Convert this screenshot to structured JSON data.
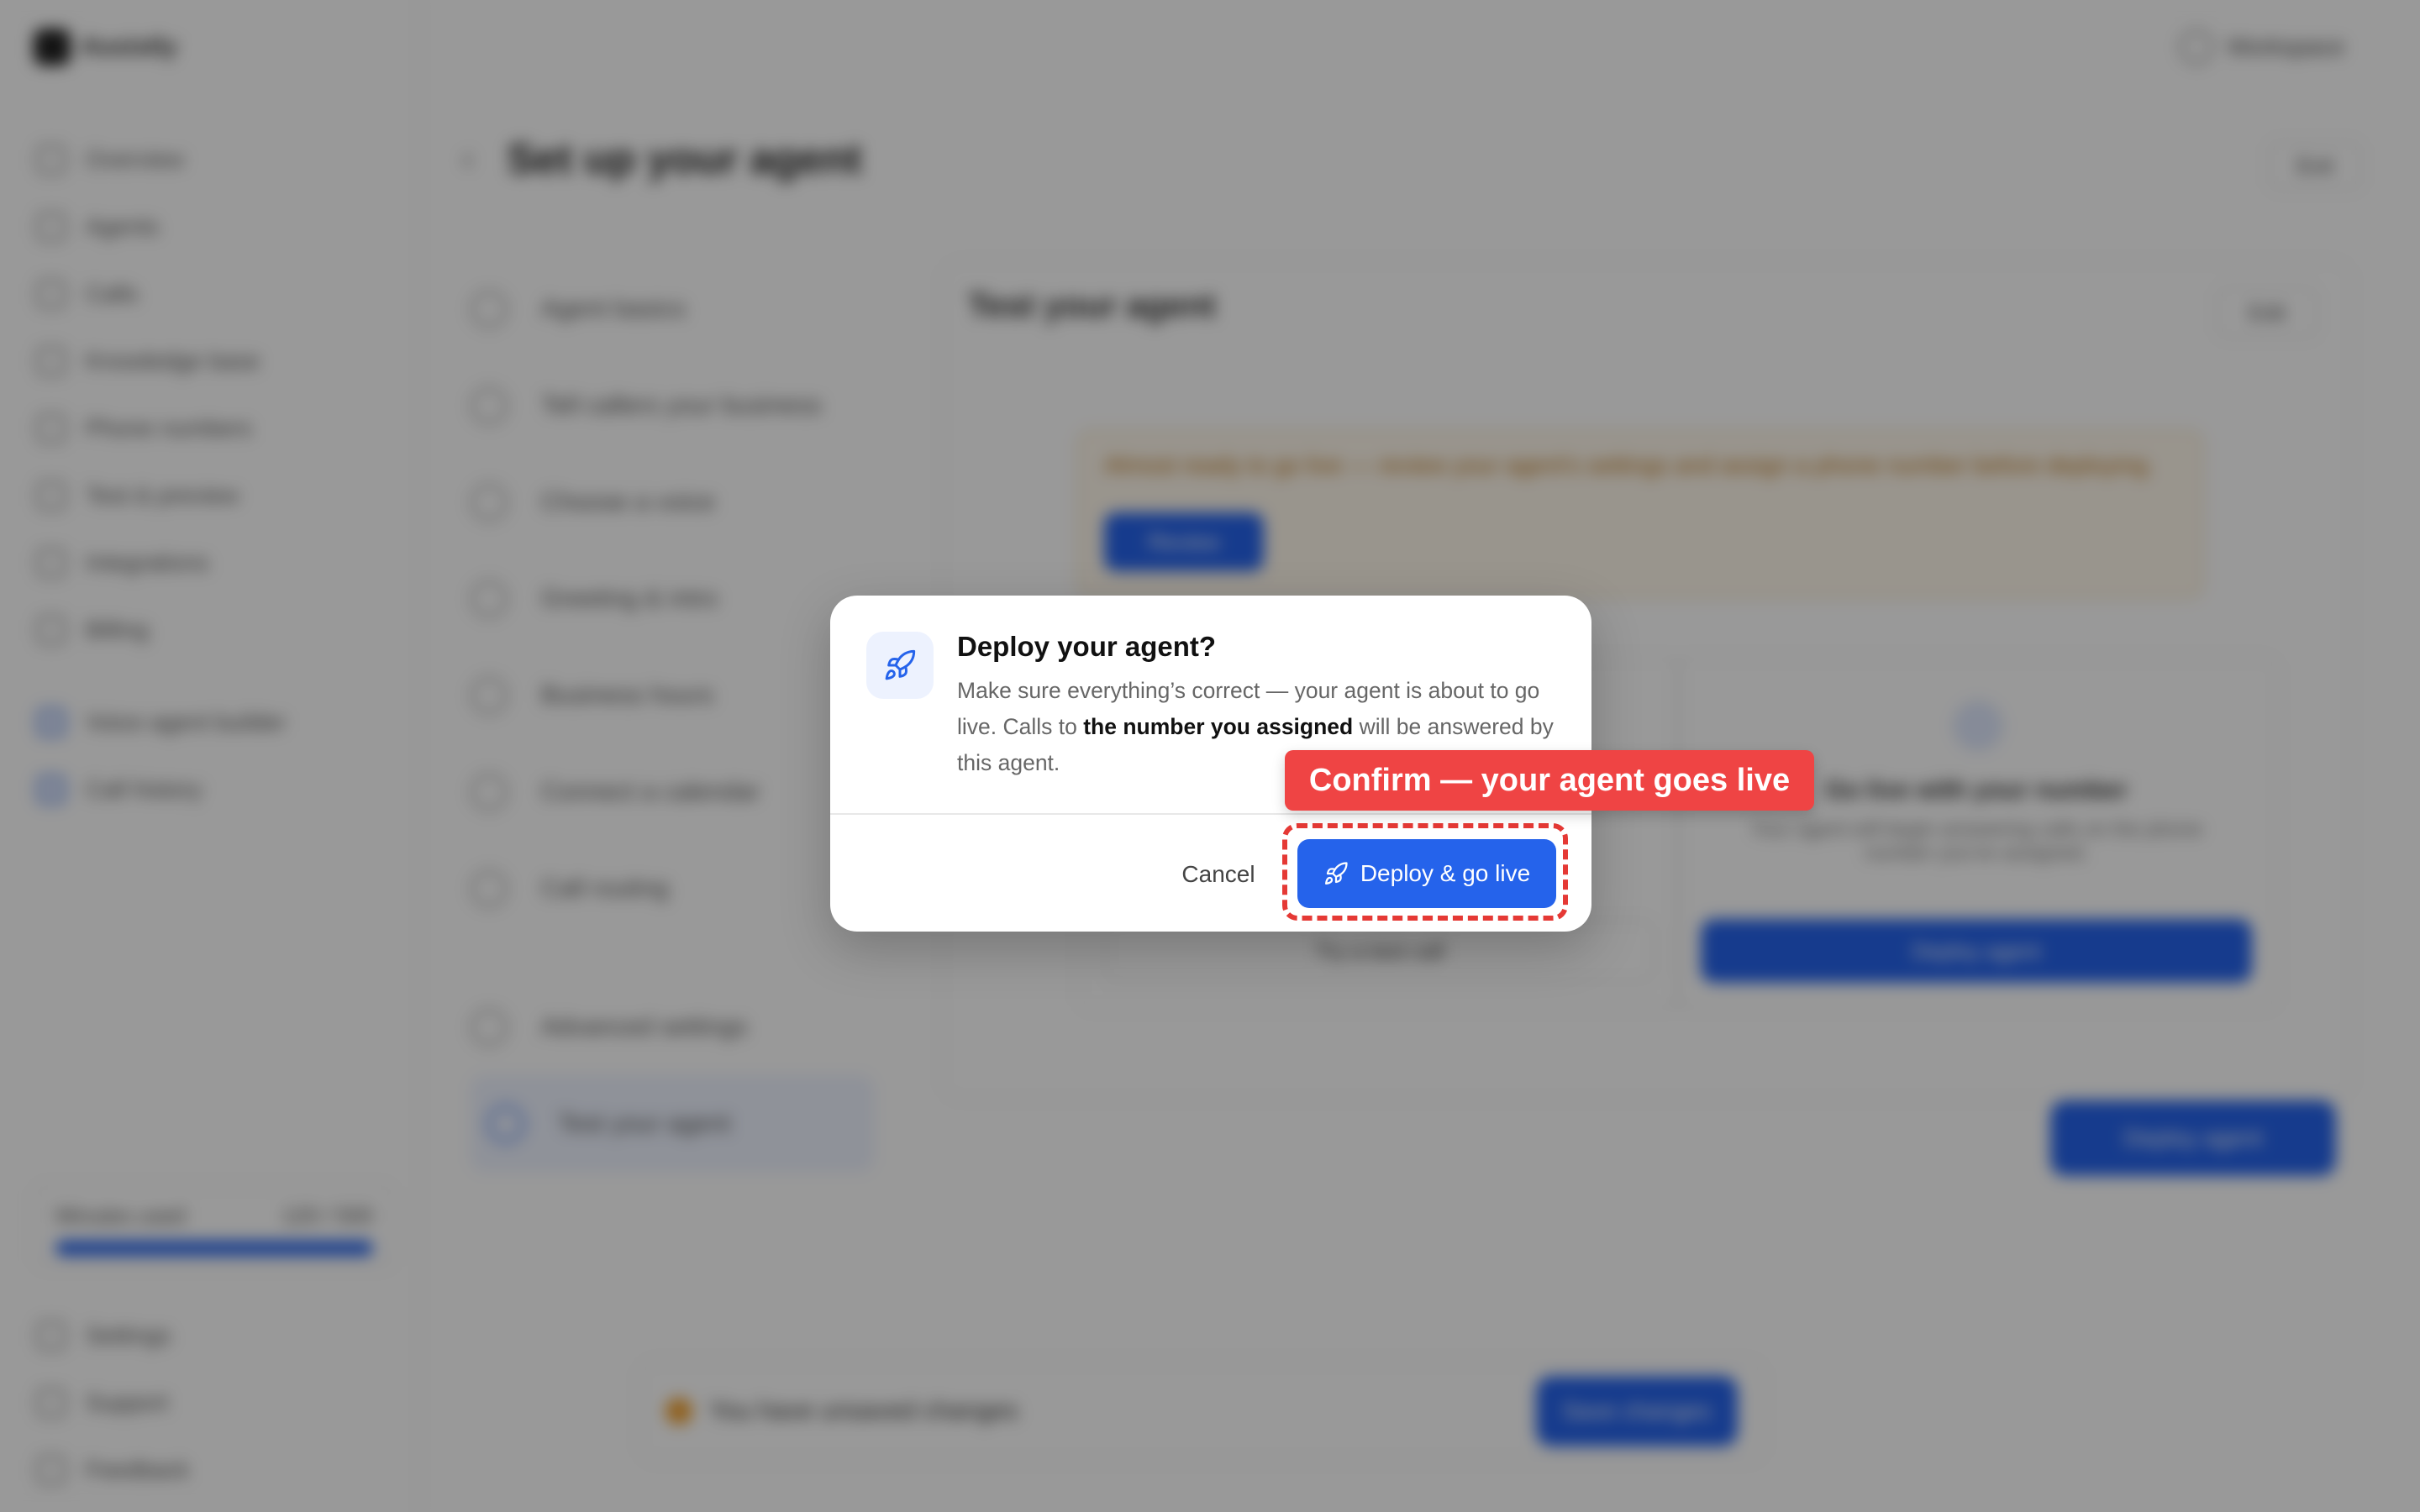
{
  "background": {
    "logo_text": "Assistly",
    "nav": [
      "Overview",
      "Agents",
      "Calls",
      "Knowledge base",
      "Phone numbers",
      "Test & preview",
      "Integrations",
      "Billing"
    ],
    "nav_group": [
      "Voice agent builder",
      "Call history"
    ],
    "usage": {
      "label": "Minutes used",
      "value": "120 / 500"
    },
    "nav_bottom": [
      "Settings",
      "Support",
      "Feedback"
    ],
    "user_label": "Workspace",
    "page_title": "Set up your agent",
    "top_button": "Exit",
    "steps": [
      "Agent basics",
      "Tell callers your business",
      "Choose a voice",
      "Greeting & intro",
      "Business hours",
      "Connect a calendar",
      "Call routing",
      "Advanced settings",
      "Test your agent"
    ],
    "panel_title": "Test your agent",
    "panel_button": "Edit",
    "warning_text": "Almost ready to go live — review your agent's settings and assign a phone number before deploying.",
    "warning_button": "Review",
    "card_left_button": "Try a test call",
    "card_right_title": "Go live with your number",
    "card_right_text": "Your agent will begin answering calls on the phone number you've assigned.",
    "card_right_button": "Deploy agent",
    "primary_cta": "Deploy agent",
    "banner_text": "You have unsaved changes",
    "banner_button": "Save changes"
  },
  "modal": {
    "icon": "rocket-icon",
    "title": "Deploy your agent?",
    "body_part1": "Make sure everything’s correct — your agent is about to go live. Calls to ",
    "body_strong": "the number you assigned",
    "body_part2": " will be answered by this agent.",
    "cancel_label": "Cancel",
    "deploy_label": "Deploy & go live"
  },
  "annotation": {
    "callout_text": "Confirm — your agent goes live",
    "color": "#ef4444"
  },
  "colors": {
    "primary": "#2563eb",
    "overlay": "rgba(0,0,0,0.40)"
  }
}
